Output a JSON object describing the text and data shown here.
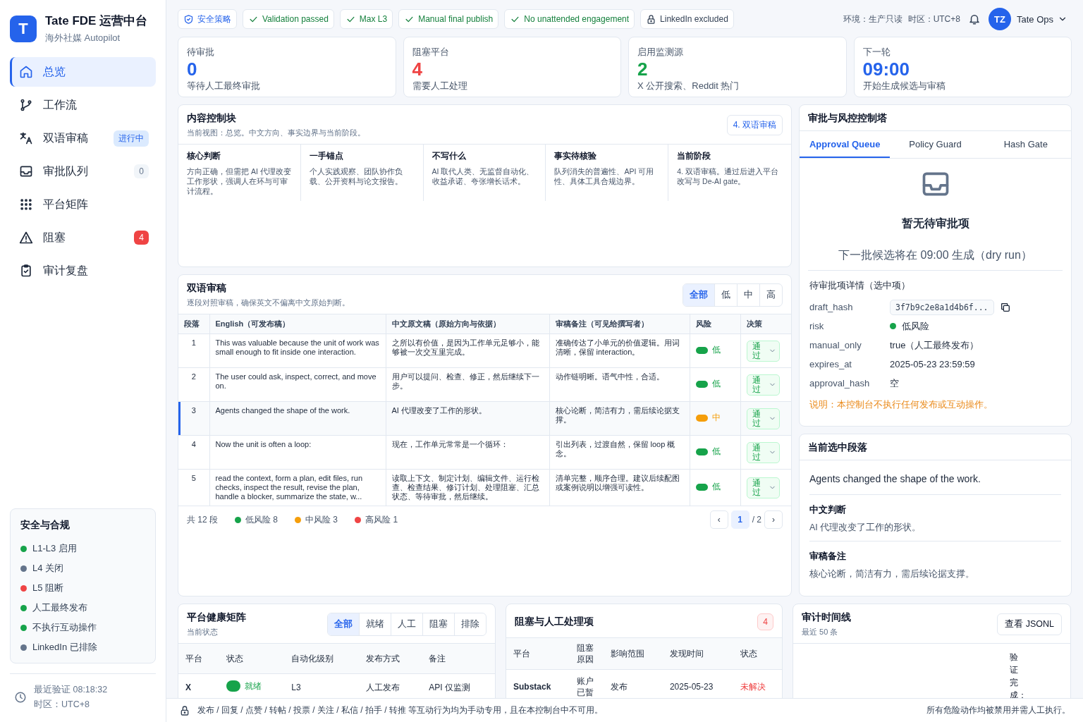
{
  "app": {
    "logo": "T",
    "title": "Tate FDE 运营中台",
    "subtitle": "海外社媒 Autopilot"
  },
  "nav": [
    {
      "label": "总览",
      "selected": true
    },
    {
      "label": "工作流",
      "selected": false
    },
    {
      "label": "双语审稿",
      "selected": false,
      "badge": "进行中",
      "kind": "status"
    },
    {
      "label": "审批队列",
      "selected": false,
      "badge": "0",
      "kind": "count"
    },
    {
      "label": "平台矩阵",
      "selected": false
    },
    {
      "label": "阻塞",
      "selected": false,
      "badge": "4",
      "kind": "alert"
    },
    {
      "label": "审计复盘",
      "selected": false
    }
  ],
  "compliance": {
    "title": "安全与合规",
    "items": [
      {
        "label": "L1-L3 启用",
        "color": "#16a34a"
      },
      {
        "label": "L4 关闭",
        "color": "#64748b"
      },
      {
        "label": "L5 阻断",
        "color": "#ef4444"
      },
      {
        "label": "人工最终发布",
        "color": "#16a34a"
      },
      {
        "label": "不执行互动操作",
        "color": "#16a34a"
      },
      {
        "label": "LinkedIn 已排除",
        "color": "#64748b"
      }
    ]
  },
  "last_verified": {
    "time": "最近验证 08:18:32",
    "timezone": "时区：UTC+8"
  },
  "policy_chips": [
    {
      "kind": "policy",
      "label": "安全策略"
    },
    {
      "kind": "pass",
      "label": "Validation passed"
    },
    {
      "kind": "pass",
      "label": "Max L3"
    },
    {
      "kind": "pass",
      "label": "Manual final publish"
    },
    {
      "kind": "pass",
      "label": "No unattended engagement"
    },
    {
      "kind": "lock",
      "label": "LinkedIn excluded"
    }
  ],
  "header": {
    "environment": "环境：生产只读",
    "timezone": "时区：UTC+8",
    "avatar": "TZ",
    "user": "Tate Ops"
  },
  "stats": [
    {
      "label": "待审批",
      "value": "0",
      "color": "#2563eb",
      "note": "等待人工最终审批"
    },
    {
      "label": "阻塞平台",
      "value": "4",
      "color": "#ef4444",
      "note": "需要人工处理"
    },
    {
      "label": "启用监测源",
      "value": "2",
      "color": "#16a34a",
      "note": "X 公开搜索、Reddit 热门"
    },
    {
      "label": "下一轮",
      "value": "09:00",
      "color": "#2563eb",
      "note": "开始生成候选与审稿"
    }
  ],
  "content_block": {
    "title": "内容控制块",
    "subtitle": "当前视图：总览。中文方向、事实边界与当前阶段。",
    "stage_button": "4. 双语审稿",
    "cells": [
      {
        "title": "核心判断",
        "text": "方向正确，但需把 AI 代理改变工作形状，强调人在环与可审计流程。"
      },
      {
        "title": "一手锚点",
        "text": "个人实践观察、团队协作负载、公开资料与论文报告。"
      },
      {
        "title": "不写什么",
        "text": "AI 取代人类、无监督自动化、收益承诺、夸张增长话术。"
      },
      {
        "title": "事实待核验",
        "text": "队列消失的普遍性、API 可用性、具体工具合规边界。"
      },
      {
        "title": "当前阶段",
        "text": "4. 双语审稿。通过后进入平台改写与 De-AI gate。"
      }
    ]
  },
  "bilingual": {
    "title": "双语审稿",
    "subtitle": "逐段对照审稿，确保英文不偏离中文原始判断。",
    "filters": [
      {
        "label": "全部",
        "selected": true
      },
      {
        "label": "低",
        "selected": false
      },
      {
        "label": "中",
        "selected": false
      },
      {
        "label": "高",
        "selected": false
      }
    ],
    "columns": [
      "段落",
      "English（可发布稿）",
      "中文原文稿（原始方向与依据）",
      "审稿备注（可见给撰写者）",
      "风险",
      "决策"
    ],
    "rows": [
      {
        "index": "1",
        "english": "This was valuable because the unit of work was small enough to fit inside one interaction.",
        "chinese": "之所以有价值，是因为工作单元足够小，能够被一次交互里完成。",
        "note": "准确传达了小单元的价值逻辑。用词清晰，保留 interaction。",
        "risk": "低",
        "color": "#16a34a",
        "decision": "通过",
        "selected": false
      },
      {
        "index": "2",
        "english": "The user could ask, inspect, correct, and move on.",
        "chinese": "用户可以提问、检查、修正，然后继续下一步。",
        "note": "动作链明晰。语气中性，合适。",
        "risk": "低",
        "color": "#16a34a",
        "decision": "通过",
        "selected": false
      },
      {
        "index": "3",
        "english": "Agents changed the shape of the work.",
        "chinese": "AI 代理改变了工作的形状。",
        "note": "核心论断，简洁有力，需后续论据支撑。",
        "risk": "中",
        "color": "#f59e0b",
        "decision": "通过",
        "selected": true
      },
      {
        "index": "4",
        "english": "Now the unit is often a loop:",
        "chinese": "现在，工作单元常常是一个循环：",
        "note": "引出列表，过渡自然，保留 loop 概念。",
        "risk": "低",
        "color": "#16a34a",
        "decision": "通过",
        "selected": false
      },
      {
        "index": "5",
        "english": "read the context, form a plan, edit files, run checks, inspect the result, revise the plan, handle a blocker, summarize the state, w...",
        "chinese": "读取上下文、制定计划、编辑文件、运行检查、检查结果、修订计划、处理阻塞、汇总状态、等待审批，然后继续。",
        "note": "清单完整，顺序合理。建议后续配图或案例说明以增强可读性。",
        "risk": "低",
        "color": "#16a34a",
        "decision": "通过",
        "selected": false
      }
    ],
    "summary": {
      "total": "共 12 段",
      "counts": [
        {
          "label": "低风险 8",
          "color": "#16a34a"
        },
        {
          "label": "中风险 3",
          "color": "#f59e0b"
        },
        {
          "label": "高风险 1",
          "color": "#ef4444"
        }
      ]
    },
    "pagination": {
      "prev": "‹",
      "page": "1",
      "total": "/ 2",
      "next": "›"
    }
  },
  "control_tower": {
    "title": "审批与风控控制塔",
    "tabs": [
      {
        "label": "Approval Queue",
        "selected": true
      },
      {
        "label": "Policy Guard",
        "selected": false
      },
      {
        "label": "Hash Gate",
        "selected": false
      }
    ],
    "empty_title": "暂无待审批项",
    "empty_note": "下一批候选将在 09:00 生成（dry run）",
    "detail_title": "待审批项详情（选中项）",
    "fields": [
      {
        "key": "draft_hash",
        "value": "3f7b9c2e8a1d4b6f...",
        "kind": "code"
      },
      {
        "key": "risk",
        "value": "低风险",
        "kind": "dot",
        "color": "#16a34a"
      },
      {
        "key": "manual_only",
        "value": "true（人工最终发布）",
        "kind": "text"
      },
      {
        "key": "expires_at",
        "value": "2025-05-23 23:59:59",
        "kind": "text"
      },
      {
        "key": "approval_hash",
        "value": "空",
        "kind": "text"
      }
    ],
    "notice": "说明：本控制台不执行任何发布或互动操作。"
  },
  "selected_paragraph": {
    "title": "当前选中段落",
    "english": "Agents changed the shape of the work.",
    "sections": [
      {
        "title": "中文判断",
        "text": "AI 代理改变了工作的形状。"
      },
      {
        "title": "审稿备注",
        "text": "核心论断，简洁有力，需后续论据支撑。"
      }
    ]
  },
  "platform_health": {
    "title": "平台健康矩阵",
    "subtitle": "当前状态",
    "filters": [
      {
        "label": "全部",
        "selected": true
      },
      {
        "label": "就绪",
        "selected": false
      },
      {
        "label": "人工",
        "selected": false
      },
      {
        "label": "阻塞",
        "selected": false
      },
      {
        "label": "排除",
        "selected": false
      }
    ],
    "columns": [
      "平台",
      "状态",
      "自动化级别",
      "发布方式",
      "备注"
    ],
    "rows": [
      {
        "platform": "X",
        "status": "就绪",
        "color": "#16a34a",
        "level": "L3",
        "method": "人工发布",
        "note": "API 仅监测"
      }
    ]
  },
  "blocked": {
    "title": "阻塞与人工处理项",
    "count": "4",
    "columns": [
      "平台",
      "阻塞原因",
      "影响范围",
      "发现时间",
      "状态"
    ],
    "rows": [
      {
        "platform": "Substack",
        "reason": "账户已暂",
        "scope": "发布",
        "found": "2025-05-23",
        "status": "未解决",
        "color": "#ef4444"
      }
    ]
  },
  "audit": {
    "title": "审计时间线",
    "subtitle": "最近 50 条",
    "button": "查看 JSONL",
    "entries": [
      "验证完成："
    ]
  },
  "footer": {
    "notice": "发布 / 回复 / 点赞 / 转帖 / 投票 / 关注 / 私信 / 拍手 / 转推 等互动行为均为手动专用，且在本控制台中不可用。",
    "right": "所有危险动作均被禁用并需人工执行。"
  }
}
